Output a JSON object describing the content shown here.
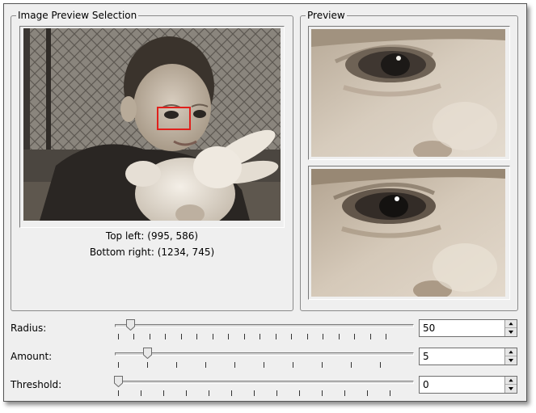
{
  "selection_group": {
    "title": "Image Preview Selection"
  },
  "preview_group": {
    "title": "Preview"
  },
  "selection_info": {
    "top_left": "Top left: (995, 586)",
    "bottom_right": "Bottom right: (1234, 745)"
  },
  "controls": [
    {
      "label": "Radius:",
      "value": "50",
      "level": 0.05
    },
    {
      "label": "Amount:",
      "value": "5",
      "level": 0.1
    },
    {
      "label": "Threshold:",
      "value": "0",
      "level": 0
    }
  ],
  "colors": {
    "selection_box": "#e0201c",
    "window_bg": "#efefef"
  }
}
